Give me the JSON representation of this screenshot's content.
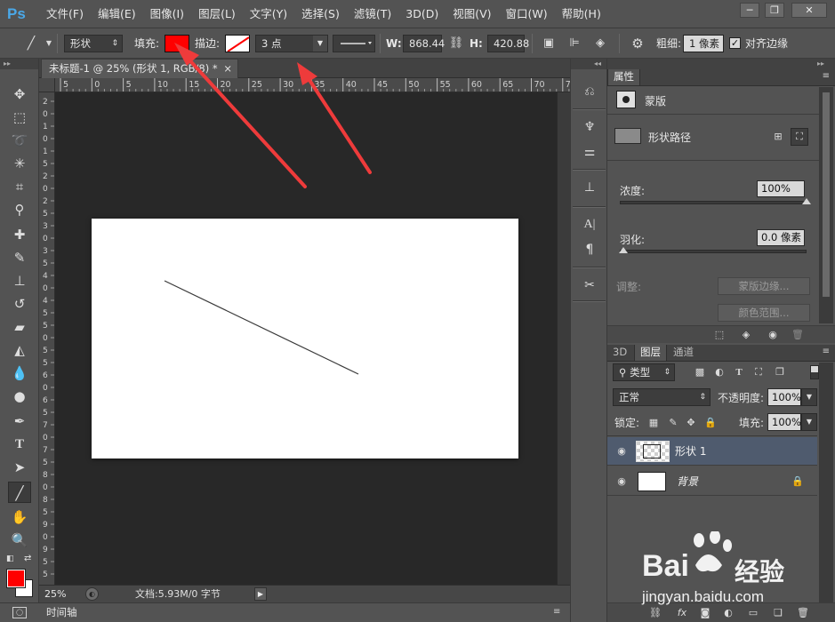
{
  "app": {
    "logo": "Ps"
  },
  "menu": [
    "文件(F)",
    "编辑(E)",
    "图像(I)",
    "图层(L)",
    "文字(Y)",
    "选择(S)",
    "滤镜(T)",
    "3D(D)",
    "视图(V)",
    "窗口(W)",
    "帮助(H)"
  ],
  "window_controls": {
    "minimize": "─",
    "restore": "❐",
    "close": "✕"
  },
  "options": {
    "mode": "形状",
    "fill_label": "填充:",
    "fill_color": "#ff0000",
    "stroke_label": "描边:",
    "stroke_size": "3 点",
    "w_label": "W:",
    "w_value": "868.44",
    "h_label": "H:",
    "h_value": "420.88",
    "weight_label": "粗细:",
    "weight_value": "1 像素",
    "align_edges_label": "对齐边缘",
    "align_edges_checked": true
  },
  "document": {
    "tab_title": "未标题-1 @ 25% (形状 1, RGB/8) *",
    "tab_close": "×",
    "zoom": "25%",
    "doc_info": "文档:5.93M/0 字节",
    "ruler_h": [
      "5",
      "0",
      "5",
      "10",
      "15",
      "20",
      "25",
      "30",
      "35",
      "40",
      "45",
      "50",
      "55",
      "60",
      "65",
      "70",
      "75"
    ],
    "ruler_v": [
      "2",
      "0",
      "1",
      "0",
      "1",
      "5",
      "2",
      "0",
      "2",
      "5",
      "3",
      "0",
      "3",
      "5",
      "4",
      "0",
      "4",
      "5",
      "5",
      "0",
      "5",
      "5",
      "6",
      "0",
      "6",
      "5",
      "7",
      "0",
      "7",
      "5",
      "8",
      "0",
      "8",
      "5",
      "9",
      "0",
      "9",
      "5",
      "5"
    ]
  },
  "timeline": {
    "label": "时间轴"
  },
  "properties": {
    "tab": "属性",
    "mask_label": "蒙版",
    "shape_path_label": "形状路径",
    "density_label": "浓度:",
    "density_value": "100%",
    "density_fraction": 1.0,
    "feather_label": "羽化:",
    "feather_value": "0.0 像素",
    "feather_fraction": 0.0,
    "adjust_label": "调整:",
    "mask_edge_button": "蒙版边缘...",
    "color_range_button": "颜色范围..."
  },
  "layers_panel": {
    "tabs": [
      "3D",
      "图层",
      "通道"
    ],
    "active_tab": "图层",
    "filter_kind": "类型",
    "blend_mode": "正常",
    "opacity_label": "不透明度:",
    "opacity_value": "100%",
    "lock_label": "锁定:",
    "fill_label": "填充:",
    "fill_value": "100%",
    "layers": [
      {
        "name": "形状 1",
        "selected": true
      },
      {
        "name": "背景",
        "selected": false
      }
    ]
  },
  "watermark": {
    "brand": "Bai",
    "brand_cn": "经验",
    "url": "jingyan.baidu.com"
  },
  "colors": {
    "foreground": "#ff0000",
    "background": "#ffffff",
    "selected_layer": "#4f5b6e",
    "annotation_arrow": "#ee3b3b",
    "accent": "#4aa8e8"
  }
}
